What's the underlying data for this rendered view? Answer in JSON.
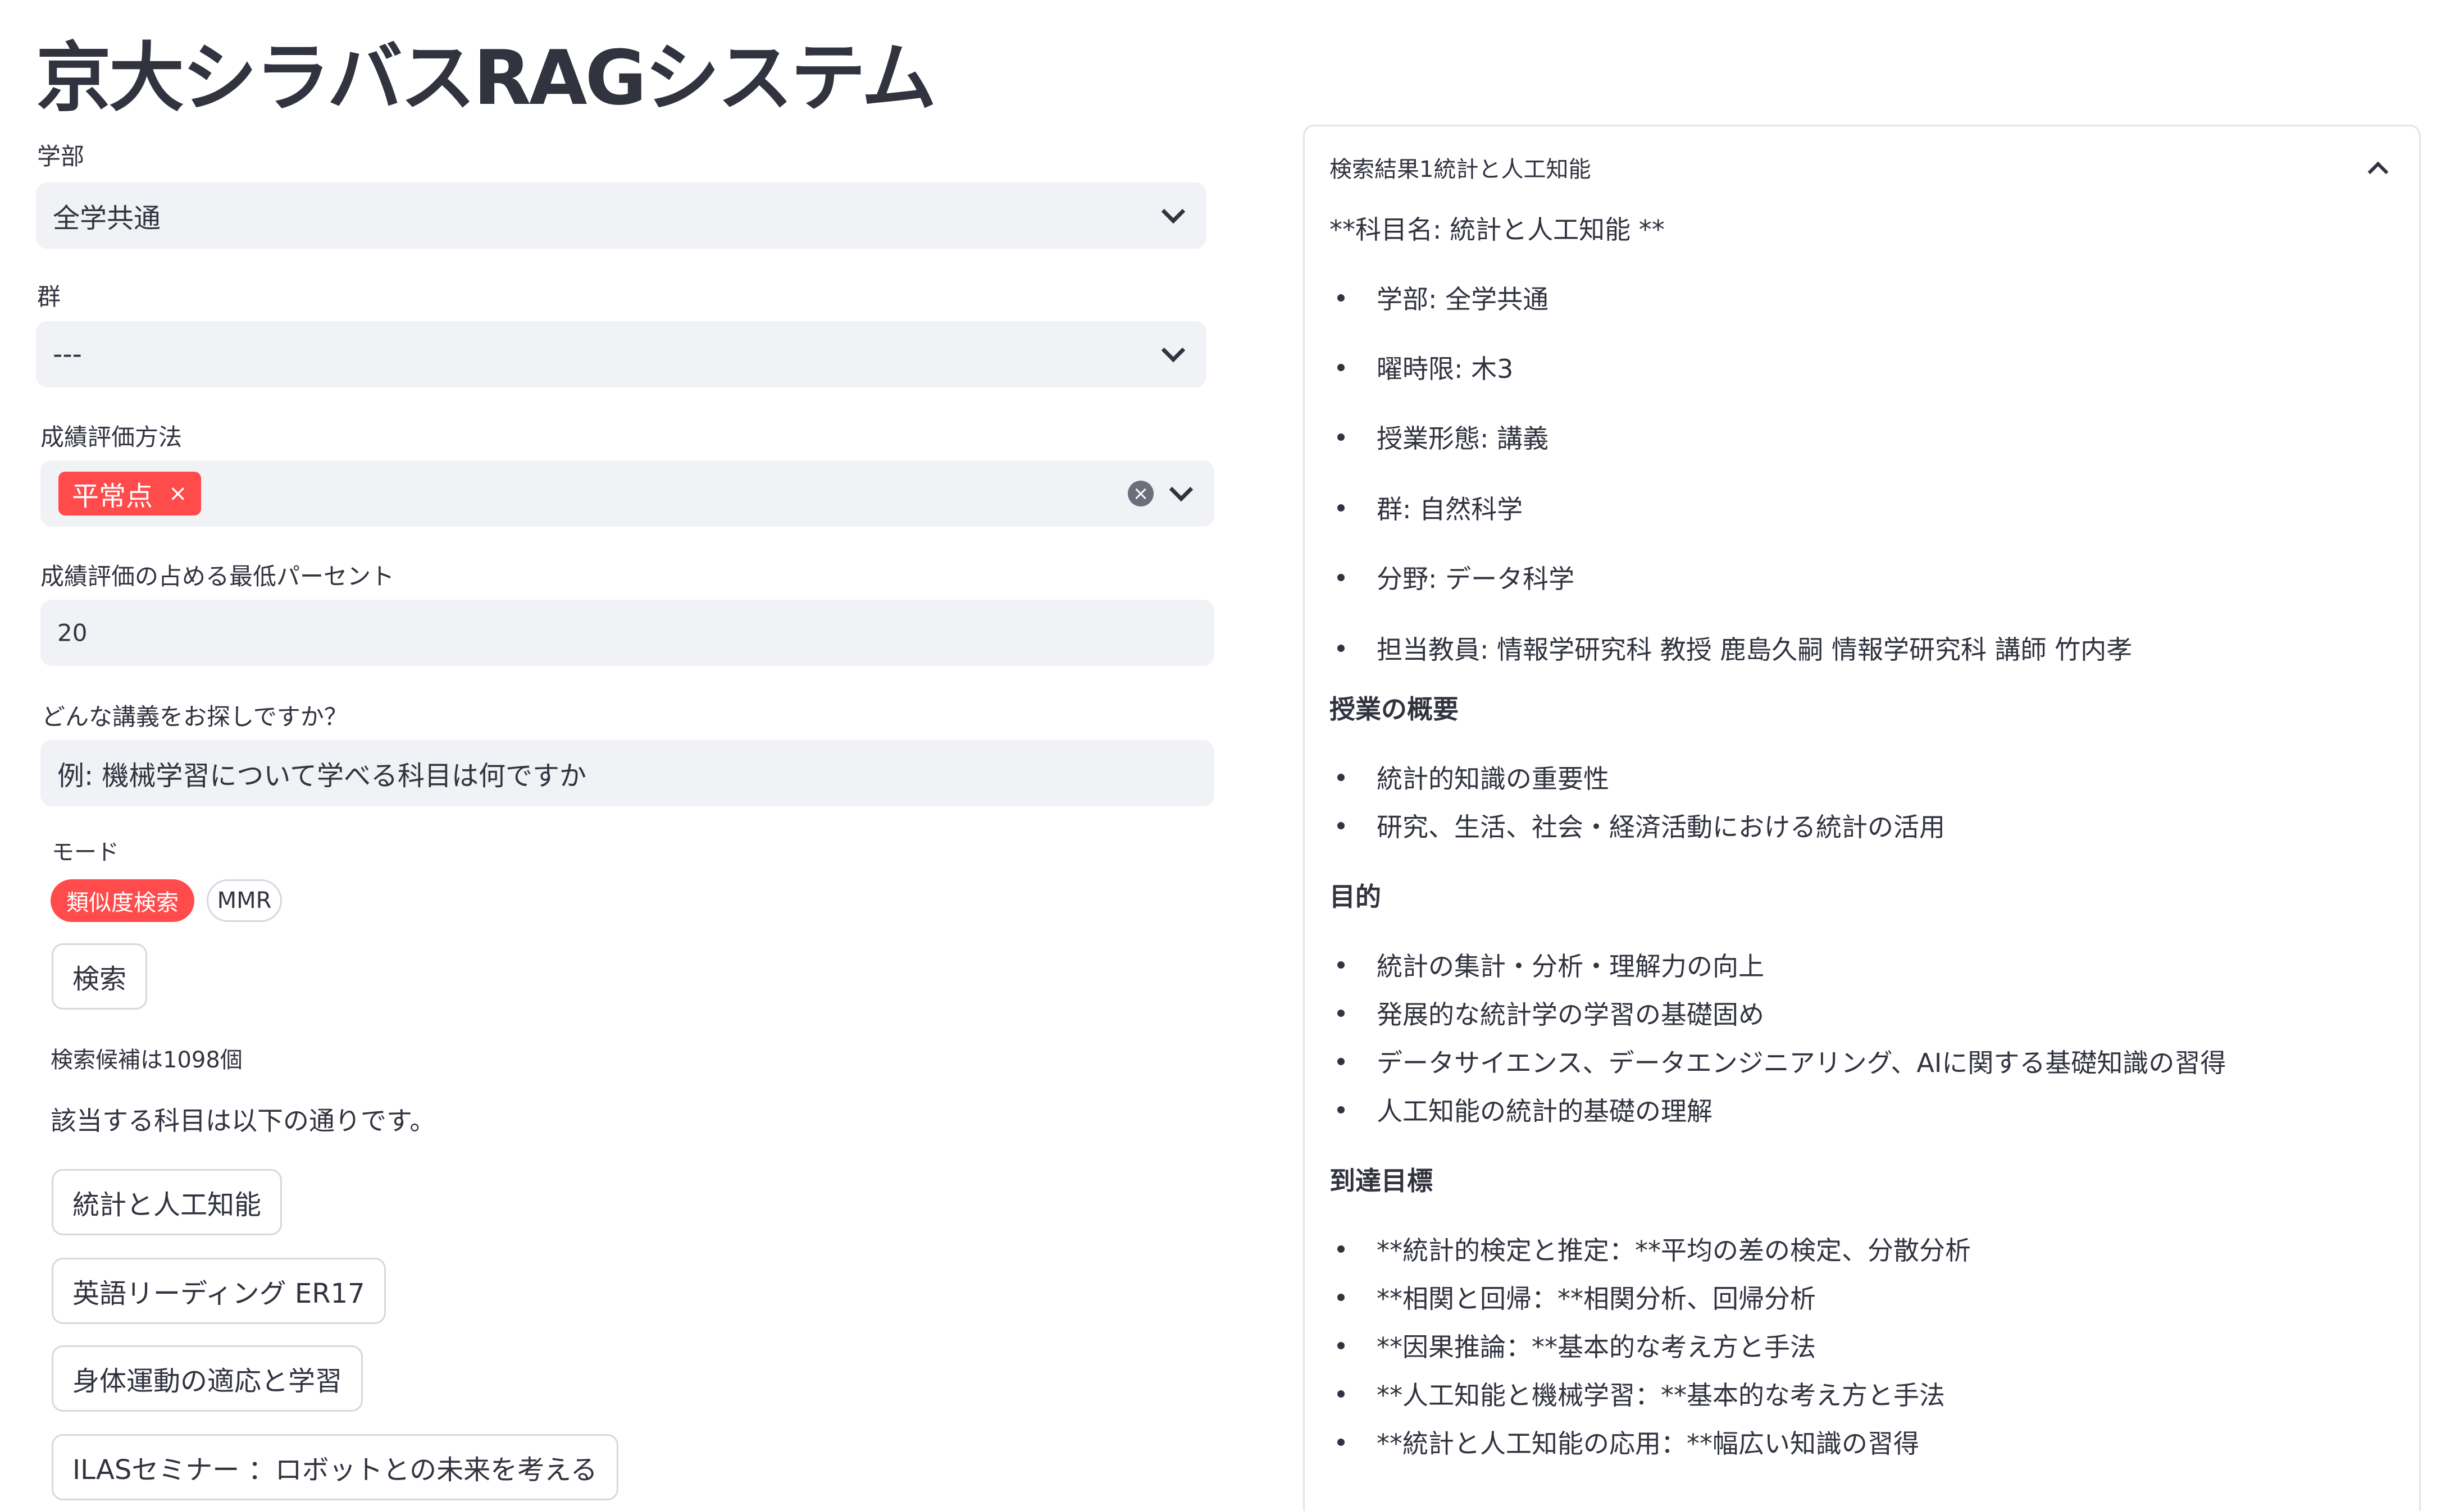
{
  "title": "京大シラバスRAGシステム",
  "form": {
    "faculty": {
      "label": "学部",
      "value": "全学共通"
    },
    "group": {
      "label": "群",
      "value": "---"
    },
    "eval_method": {
      "label": "成績評価方法",
      "tag": "平常点",
      "tag_remove": "×",
      "clear": "×"
    },
    "min_percent": {
      "label": "成績評価の占める最低パーセント",
      "value": "20"
    },
    "query": {
      "label": "どんな講義をお探しですか？",
      "placeholder": "例: 機械学習について学べる科目は何ですか"
    },
    "mode": {
      "label": "モード",
      "options": [
        "類似度検索",
        "MMR"
      ],
      "selected": "類似度検索"
    },
    "search_button": "検索"
  },
  "results": {
    "candidates": "検索候補は1098個",
    "intro": "該当する科目は以下の通りです。",
    "courses": [
      "統計と人工知能",
      "英語リーディング ER17",
      "身体運動の適応と学習",
      "ILASセミナー ：ロボットとの未来を考える"
    ]
  },
  "detail": {
    "header": "検索結果1統計と人工知能",
    "course_name": "**科目名: 統計と人工知能 **",
    "meta": [
      "学部: 全学共通",
      "曜時限: 木3",
      "授業形態: 講義",
      "群: 自然科学",
      "分野: データ科学",
      "担当教員: 情報学研究科 教授 鹿島久嗣 情報学研究科 講師 竹内孝"
    ],
    "overview_heading": "授業の概要",
    "overview": [
      "統計的知識の重要性",
      "研究、生活、社会・経済活動における統計の活用"
    ],
    "purpose_heading": "目的",
    "purpose": [
      "統計の集計・分析・理解力の向上",
      "発展的な統計学の学習の基礎固め",
      "データサイエンス、データエンジニアリング、AIに関する基礎知識の習得",
      "人工知能の統計的基礎の理解"
    ],
    "goals_heading": "到達目標",
    "goals": [
      "**統計的検定と推定：**平均の差の検定、分散分析",
      "**相関と回帰：**相関分析、回帰分析",
      "**因果推論：**基本的な考え方と手法",
      "**人工知能と機械学習：**基本的な考え方と手法",
      "**統計と人工知能の応用：**幅広い知識の習得"
    ]
  },
  "colors": {
    "accent": "#ff4b4b",
    "input_bg": "#f0f2f6",
    "text": "#31333f"
  }
}
